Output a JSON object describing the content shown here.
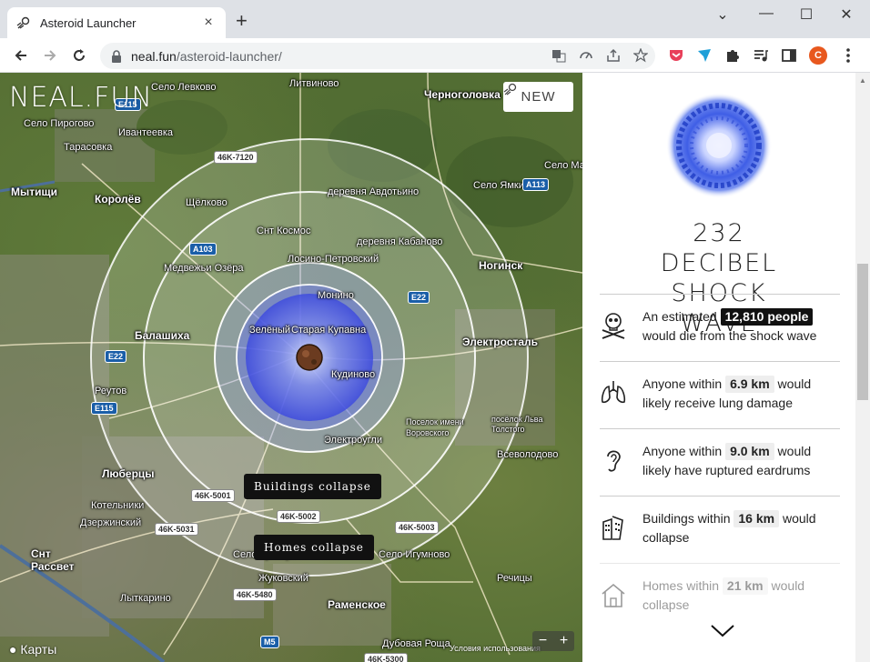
{
  "browser": {
    "tab_title": "Asteroid Launcher",
    "url_host": "neal.fun",
    "url_path": "/asteroid-launcher/",
    "new_tab_symbol": "+",
    "tab_close_symbol": "×",
    "profile_initial": "C",
    "window_controls": {
      "minimize": "—",
      "maximize": "☐",
      "close": "✕",
      "dropdown": "⌄"
    }
  },
  "site": {
    "logo": "NEAL.FUN",
    "new_button": "NEW"
  },
  "map": {
    "damage_labels": {
      "buildings": "Buildings collapse",
      "homes": "Homes collapse"
    },
    "footer_brand": "Карты",
    "credit": "Условия использования",
    "zoom_minus": "−",
    "zoom_plus": "+",
    "places": [
      {
        "name": "Мытищи",
        "big": true
      },
      {
        "name": "Королёв",
        "big": true
      },
      {
        "name": "Ивантеевка",
        "big": false
      },
      {
        "name": "Балашиха",
        "big": true
      },
      {
        "name": "Реутов",
        "big": false
      },
      {
        "name": "Люберцы",
        "big": true
      },
      {
        "name": "Котельники",
        "big": false
      },
      {
        "name": "Дзержинский",
        "big": false
      },
      {
        "name": "Лыткарино",
        "big": false
      },
      {
        "name": "Жуковский",
        "big": false
      },
      {
        "name": "Раменское",
        "big": true
      },
      {
        "name": "Ногинск",
        "big": true
      },
      {
        "name": "Электросталь",
        "big": true
      },
      {
        "name": "Черноголовка",
        "big": true
      },
      {
        "name": "Лосино-Петровский",
        "big": false
      },
      {
        "name": "Монино",
        "big": false
      },
      {
        "name": "Щёлково",
        "big": false
      },
      {
        "name": "Старая Купавна",
        "big": false
      },
      {
        "name": "Электроугли",
        "big": false
      },
      {
        "name": "Кудиново",
        "big": false
      },
      {
        "name": "Зелёный",
        "big": false
      },
      {
        "name": "Медвежьи Озёра",
        "big": false
      },
      {
        "name": "Село Пирогово",
        "big": false
      },
      {
        "name": "Тарасовка",
        "big": false
      },
      {
        "name": "Село Левково",
        "big": false
      },
      {
        "name": "Литвиново",
        "big": false
      },
      {
        "name": "Село Мамо",
        "big": false
      },
      {
        "name": "Село Ямкино",
        "big": false
      },
      {
        "name": "деревня Авдотьино",
        "big": false
      },
      {
        "name": "деревня Кабаново",
        "big": false
      },
      {
        "name": "Снт Космос",
        "big": false
      },
      {
        "name": "Поселок имени Воровского",
        "big": false
      },
      {
        "name": "посёлок Льва Толстого",
        "big": false
      },
      {
        "name": "Всеволодово",
        "big": false
      },
      {
        "name": "Речицы",
        "big": false
      },
      {
        "name": "Село Игумново",
        "big": false
      },
      {
        "name": "Снт Рассвет",
        "big": true
      },
      {
        "name": "Дубовая Роща",
        "big": false
      },
      {
        "name": "Село Кривцы",
        "big": false
      }
    ],
    "road_signs": {
      "r1": "46K-7120",
      "r2": "A103",
      "r3": "E115",
      "r4": "E22",
      "r5": "E22",
      "r6": "A113",
      "r7": "E115",
      "r8": "46K-5001",
      "r9": "46K-5002",
      "r10": "46K-5031",
      "r11": "46K-5003",
      "r12": "46K-5480",
      "r13": "M5",
      "r14": "46K-5300"
    }
  },
  "panel": {
    "title": "232 Decibel Shock Wave",
    "stats": [
      {
        "pre": "An estimated",
        "value": "12,810 people",
        "post": "would die from the shock wave",
        "icon": "skull-crossbones-icon"
      },
      {
        "pre": "Anyone within",
        "value": "6.9 km",
        "post": "would likely receive lung damage",
        "icon": "lungs-icon"
      },
      {
        "pre": "Anyone within",
        "value": "9.0 km",
        "post": "would likely have ruptured eardrums",
        "icon": "ear-icon"
      },
      {
        "pre": "Buildings within",
        "value": "16 km",
        "post": "would collapse",
        "icon": "collapsing-building-icon"
      },
      {
        "pre": "Homes within",
        "value": "21 km",
        "post": "would collapse",
        "icon": "house-icon"
      }
    ]
  },
  "colors": {
    "shock_blue": "#2a3ee8",
    "ring": "#ffffff",
    "panel_text": "#222222",
    "highlight_dark": "#111111"
  }
}
